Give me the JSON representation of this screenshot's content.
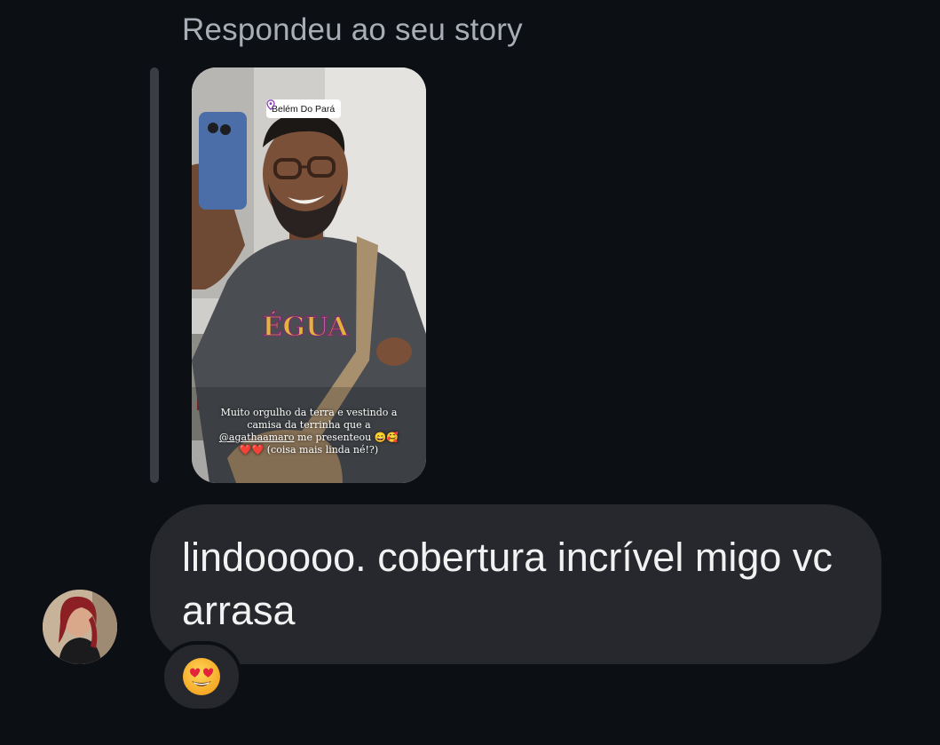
{
  "reply_header": "Respondeu ao seu story",
  "story": {
    "location": "Belém Do Pará",
    "caption_line1": "Muito orgulho da terra e vestindo a",
    "caption_line2": "camisa da terrinha que a",
    "caption_mention": "@agathaamaro",
    "caption_line3_rest": " me presenteou 😄🥰",
    "caption_line4": "❤️❤️ (coisa mais linda né!?)",
    "shirt_text": "ÉGUA"
  },
  "message": {
    "text": "lindooooo. cobertura incrível migo vc arrasa"
  },
  "reaction": {
    "emoji_name": "heart-eyes-emoji"
  },
  "colors": {
    "background": "#0c0f14",
    "bubble": "#26282d",
    "header_text": "#a9adb5",
    "message_text": "#f2f2f3"
  }
}
